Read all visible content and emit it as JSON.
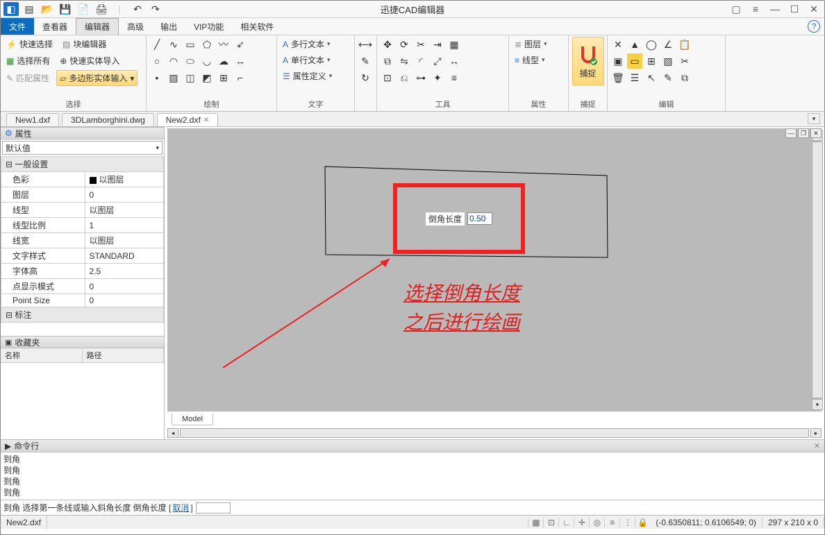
{
  "app": {
    "title": "迅捷CAD编辑器"
  },
  "menu": [
    "文件",
    "查看器",
    "编辑器",
    "高级",
    "输出",
    "VIP功能",
    "相关软件"
  ],
  "ribbon": {
    "selectGroup": {
      "quickSelect": "快速选择",
      "blockEditor": "块编辑器",
      "selectAll": "选择所有",
      "quickImport": "快速实体导入",
      "matchProp": "匹配属性",
      "polyInput": "多边形实体输入",
      "label": "选择"
    },
    "draw": {
      "label": "绘制"
    },
    "text": {
      "mtext": "多行文本",
      "stext": "单行文本",
      "attdef": "属性定义",
      "label": "文字"
    },
    "tools": {
      "label": "工具"
    },
    "props": {
      "layer": "图层",
      "ltype": "线型",
      "label": "属性"
    },
    "snap": {
      "btn": "捕捉",
      "label": "捕捉"
    },
    "edit": {
      "label": "编辑"
    }
  },
  "tabs": [
    "New1.dxf",
    "3DLamborghini.dwg",
    "New2.dxf"
  ],
  "propPanel": {
    "title": "属性",
    "default": "默认值",
    "section1": "一般设置",
    "rows": [
      {
        "k": "色彩",
        "v": "以图层",
        "sq": true
      },
      {
        "k": "图层",
        "v": "0"
      },
      {
        "k": "线型",
        "v": "以图层"
      },
      {
        "k": "线型比例",
        "v": "1"
      },
      {
        "k": "线宽",
        "v": "以图层"
      },
      {
        "k": "文字样式",
        "v": "STANDARD"
      },
      {
        "k": "字体高",
        "v": "2.5"
      },
      {
        "k": "点显示模式",
        "v": "0"
      },
      {
        "k": "Point Size",
        "v": "0"
      }
    ],
    "section2": "标注",
    "fav": "收藏夹",
    "favCols": [
      "名称",
      "路径"
    ]
  },
  "canvas": {
    "modelTab": "Model",
    "chamferLabel": "倒角长度",
    "chamferValue": "0.50",
    "annotation": "选择倒角长度\n之后进行绘画"
  },
  "cmd": {
    "title": "命令行",
    "log": [
      "到角",
      "到角",
      "到角",
      "到角"
    ],
    "prompt": "到角  选择第一条线或输入斜角长度  倒角长度 [ ",
    "cancel": "取消",
    "promptEnd": " ] "
  },
  "status": {
    "file": "New2.dxf",
    "coords": "(-0.6350811; 0.6106549; 0)",
    "dim": "297 x 210 x 0"
  }
}
